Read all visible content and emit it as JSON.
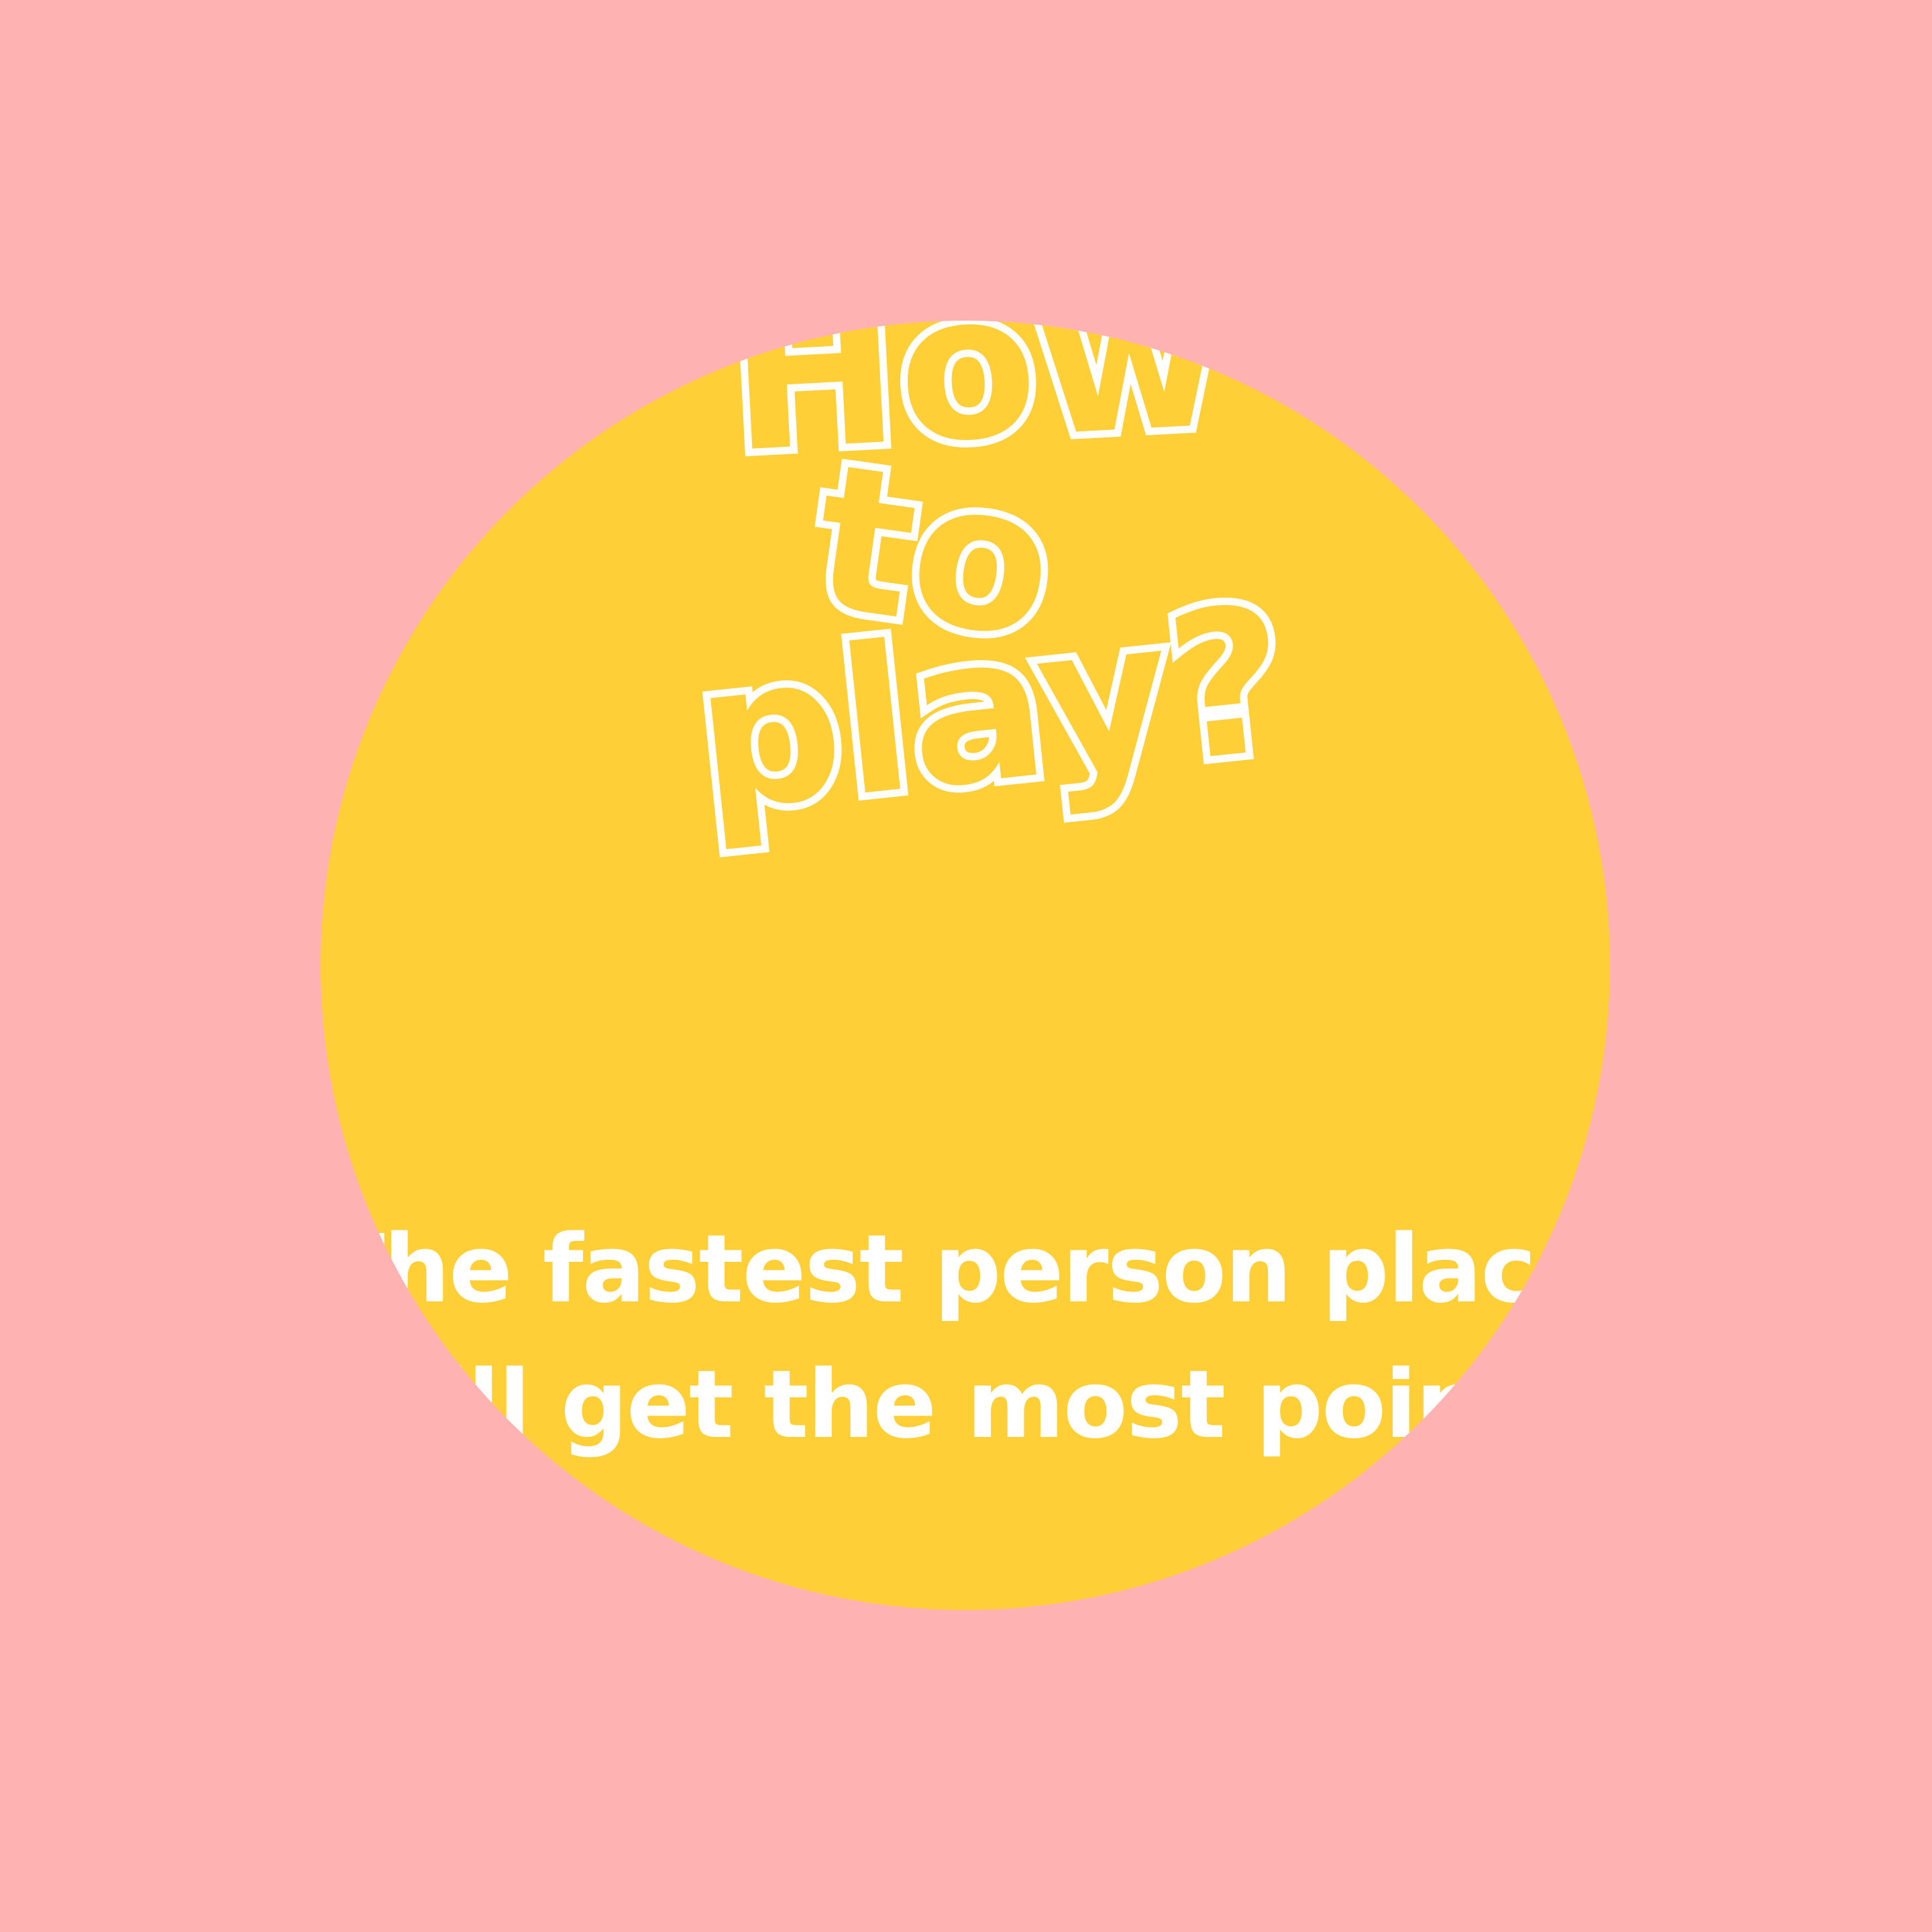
{
  "colors": {
    "background": "#FFB2B2",
    "circle": "#FECF37",
    "text": "#FFFFFF"
  },
  "title": {
    "line1": "How",
    "line2": "to",
    "line3": "play?"
  },
  "body": {
    "line1": "The fastest person placed",
    "line2": "will get the most points"
  }
}
